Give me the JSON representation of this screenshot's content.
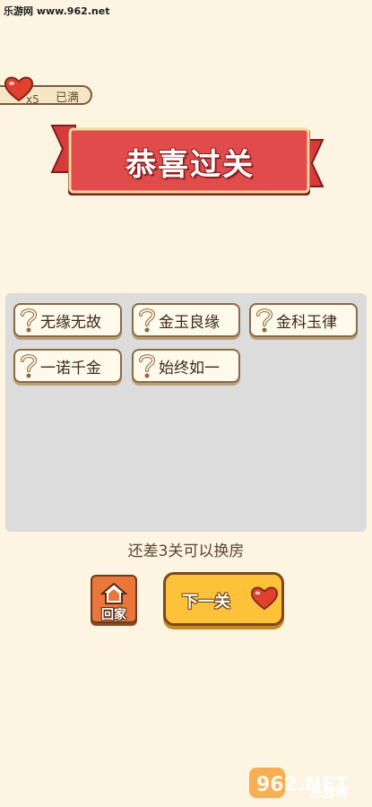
{
  "watermark": {
    "text": "乐游网 www.962.net"
  },
  "lives": {
    "count_text": "x5",
    "status": "已满"
  },
  "banner": {
    "title": "恭喜过关"
  },
  "words": [
    {
      "text": "无缘无故"
    },
    {
      "text": "金玉良缘"
    },
    {
      "text": "金科玉律"
    },
    {
      "text": "一诺千金"
    },
    {
      "text": "始终如一"
    }
  ],
  "hint": "还差3关可以换房",
  "buttons": {
    "home_label": "回家",
    "next_label": "下一关"
  },
  "brand": {
    "logo_text": "962.NET",
    "sub_text": "乐游网"
  },
  "colors": {
    "heart": "#e0412f",
    "banner_red": "#e14b4b",
    "next_yellow": "#fdc23a",
    "home_orange": "#e9763a"
  }
}
